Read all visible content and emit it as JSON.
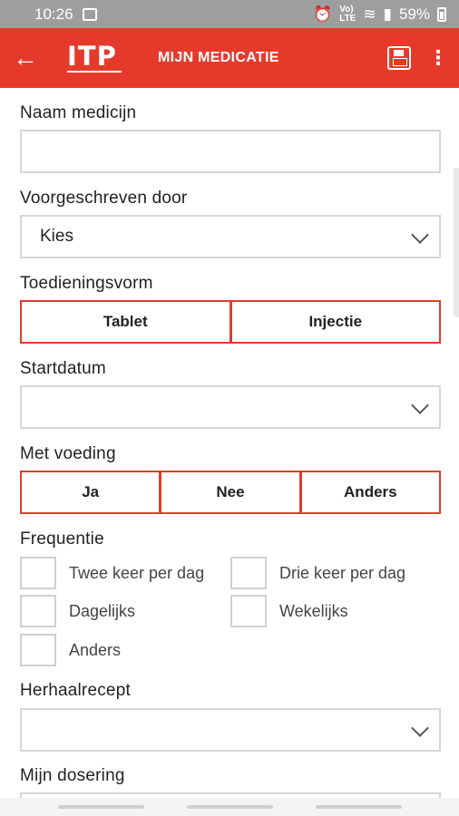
{
  "status_bar": {
    "time": "10:26",
    "network_label": "Vo)\nLTE",
    "battery": "59%"
  },
  "app_bar": {
    "back_icon": "arrow-left-icon",
    "logo_text": "ITP",
    "title": "MIJN MEDICATIE",
    "save_icon": "save-icon",
    "more_icon": "more-vert-icon",
    "accent_color": "#e53a2b"
  },
  "form": {
    "medicine_name": {
      "label": "Naam medicijn",
      "value": ""
    },
    "prescribed_by": {
      "label": "Voorgeschreven door",
      "value": "Kies"
    },
    "administration": {
      "label": "Toedieningsvorm",
      "options": [
        "Tablet",
        "Injectie"
      ]
    },
    "start_date": {
      "label": "Startdatum",
      "value": ""
    },
    "with_food": {
      "label": "Met voeding",
      "options": [
        "Ja",
        "Nee",
        "Anders"
      ]
    },
    "frequency": {
      "label": "Frequentie",
      "options": [
        "Twee keer per dag",
        "Drie keer per dag",
        "Dagelijks",
        "Wekelijks",
        "Anders"
      ]
    },
    "repeat_prescription": {
      "label": "Herhaalrecept",
      "value": ""
    },
    "my_dosage": {
      "label": "Mijn dosering"
    }
  }
}
